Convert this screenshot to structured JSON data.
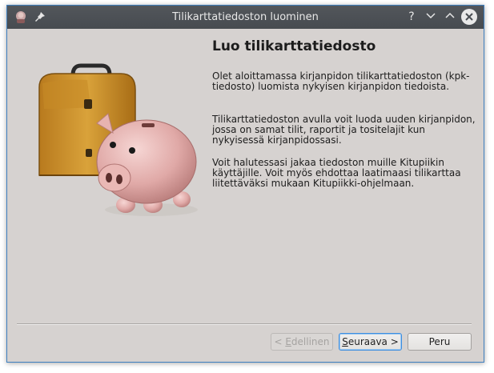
{
  "window": {
    "title": "Tilikarttatiedoston luominen",
    "accent": "#3e7fbf",
    "titlebar_buttons": [
      "?",
      "⌄",
      "⌃"
    ]
  },
  "main": {
    "heading": "Luo tilikarttatiedosto",
    "paragraphs": [
      "Olet aloittamassa kirjanpidon tilikarttatiedoston (kpk-tiedosto) luomista nykyisen kirjanpidon tiedoista.",
      "Tilikarttatiedoston avulla voit luoda uuden kirjanpidon, jossa on samat tilit, raportit ja tositelajit kun nykyisessä kirjanpidossasi.",
      "Voit halutessasi jakaa tiedoston muille Kitupiikin käyttäjille. Voit myös ehdottaa laatimaasi tilikarttaa liitettäväksi mukaan Kitupiikki-ohjelmaan."
    ]
  },
  "buttons": {
    "back_prefix": "< ",
    "back_mnemonic": "E",
    "back_rest": "dellinen",
    "next_mnemonic": "S",
    "next_rest": "euraava >",
    "cancel": "Peru"
  }
}
